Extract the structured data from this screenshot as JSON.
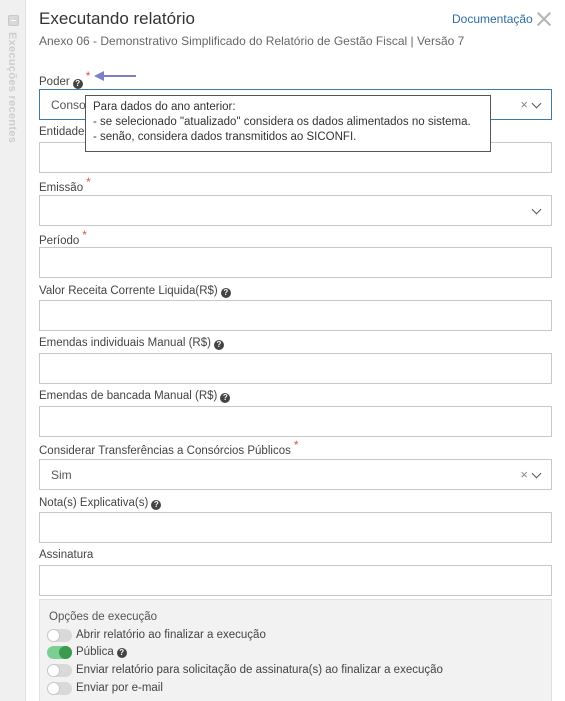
{
  "sidebar": {
    "label": "Execuções recentes"
  },
  "header": {
    "title": "Executando relatório",
    "subtitle": "Anexo 06 - Demonstrativo Simplificado do Relatório de Gestão Fiscal | Versão 7",
    "doc_link": "Documentação"
  },
  "fields": {
    "poder": {
      "label": "Poder",
      "value": "Conso"
    },
    "entidade": {
      "label": "Entidade",
      "value": ""
    },
    "emissao": {
      "label": "Emissão",
      "value": ""
    },
    "periodo": {
      "label": "Período",
      "value": ""
    },
    "valor_rcl": {
      "label": "Valor Receita Corrente Liquida(R$)",
      "value": ""
    },
    "emendas_individuais": {
      "label": "Emendas individuais Manual (R$)",
      "value": ""
    },
    "emendas_bancada": {
      "label": "Emendas de bancada Manual (R$)",
      "value": ""
    },
    "consorcios": {
      "label": "Considerar Transferências a Consórcios Públicos",
      "value": "Sim"
    },
    "nota": {
      "label": "Nota(s) Explicativa(s)",
      "value": ""
    },
    "assinatura": {
      "label": "Assinatura",
      "value": ""
    }
  },
  "tooltip": {
    "line1": "Para dados do ano anterior:",
    "line2": "- se selecionado \"atualizado\" considera os dados alimentados no sistema.",
    "line3": "- senão, considera dados transmitidos ao SICONFI."
  },
  "options": {
    "title": "Opções de execução",
    "items": [
      {
        "label": "Abrir relatório ao finalizar a execução",
        "on": false
      },
      {
        "label": "Pública",
        "on": true
      },
      {
        "label": "Enviar relatório para solicitação de assinatura(s) ao finalizar a execução",
        "on": false
      },
      {
        "label": "Enviar por e-mail",
        "on": false
      }
    ]
  },
  "colors": {
    "accent": "#2d6ca2",
    "required": "#d9534f",
    "toggle_on": "#3a9a4f",
    "arrow": "#7b7fc4"
  }
}
